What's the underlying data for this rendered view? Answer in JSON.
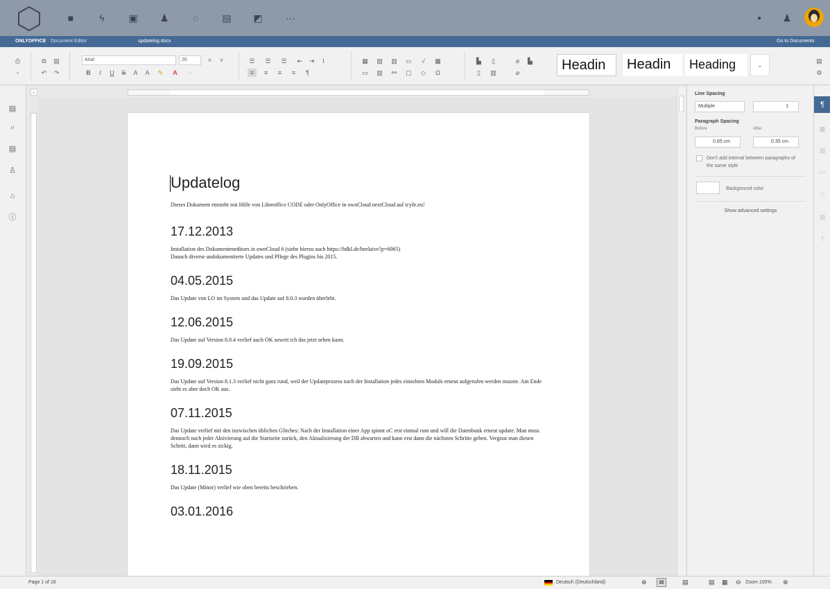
{
  "app": {
    "brand": "ONLYOFFICE",
    "editor_name": "Document Editor",
    "file_name": "updatelog.docx",
    "go_to_documents": "Go to Documents",
    "nav_more": "···",
    "colors": {
      "nav_bg": "#8e9aa9",
      "title_bar": "#446995",
      "toolbar_bg": "#f1f1f1",
      "accent": "#446995"
    }
  },
  "nav_icons": [
    "files-icon",
    "activity-icon",
    "gallery-icon",
    "contacts-icon",
    "circles-icon",
    "calendar-icon",
    "notes-icon",
    "more-icon"
  ],
  "toolbar": {
    "font_name": "Arial",
    "font_size": "20",
    "styles": [
      "Headin",
      "Headin",
      "Heading"
    ]
  },
  "left_icons": [
    "file-icon",
    "search-icon",
    "comments-icon",
    "review-icon",
    "plugins-icon",
    "about-icon"
  ],
  "document": {
    "title": "Updatelog",
    "intro": "Dieses Dokument entsteht mit Hilfe von Libreoffice CODE oder OnlyOffice in ownCloud nextCloud auf tcyfe.eu!",
    "sections": [
      {
        "date": "17.12.2013",
        "body": "Installation des Dokumenteneditors in ownCloud 6 (siehe hierzu auch https://bdkl.de/heelaive?p=6065)\nDanach diverse undokumentierte Updates und Pflege des Plugins bis 2015."
      },
      {
        "date": "04.05.2015",
        "body": "Das Update von LO im System und das Update auf 8.0.3 wurden überlebt."
      },
      {
        "date": "12.06.2015",
        "body": "Das Update auf Version 8.0.4 verlief auch OK soweit ich das jetzt sehen kann."
      },
      {
        "date": "19.09.2015",
        "body": "Das Update auf Version 8.1.3 verlief nicht ganz rund, weil der Updateprozess nach der Installation jedes einzelnen Moduls erneut aufgerufen werden musste. Am Ende sieht es aber doch OK aus."
      },
      {
        "date": "07.11.2015",
        "body": "Das Update verlief mit den inzwischen üblichen Glitches: Nach der Installation einer App spinnt oC erst einmal rum und will die Datenbank erneut update. Man muss dennoch nach jeder Aktivierung auf die Startseite zurück, den Aktualisierung der DB abwarten und kann erst dann die nächsten Schritte gehen. Vergisst man diesen Schritt, dann wird es zickig."
      },
      {
        "date": "18.11.2015",
        "body": "Das Update (Minor) verlief wie oben bereits beschrieben."
      },
      {
        "date": "03.01.2016",
        "body": ""
      }
    ]
  },
  "right_panel": {
    "line_spacing_label": "Line Spacing",
    "line_spacing_mode": "Multiple",
    "line_spacing_value": "1",
    "paragraph_spacing_label": "Paragraph Spacing",
    "before_label": "Before",
    "after_label": "After",
    "before_value": "0.85 cm",
    "after_value": "0.35 cm",
    "dont_add_interval": "Don't add interval between paragraphs of the same style",
    "background_color": "Background color",
    "show_advanced": "Show advanced settings"
  },
  "status_bar": {
    "page_info": "Page 1 of 16",
    "language": "Deutsch (Deutschland)",
    "zoom": "Zoom 100%"
  }
}
